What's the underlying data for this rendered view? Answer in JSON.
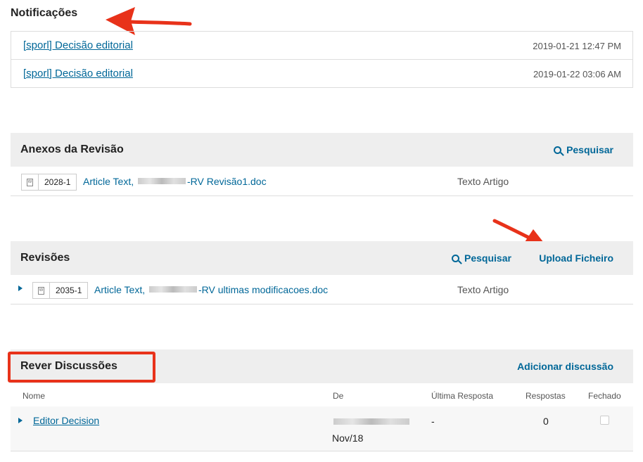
{
  "notifications": {
    "title": "Notificações",
    "items": [
      {
        "label": "[sporl] Decisão editorial",
        "date": "2019-01-21 12:47 PM"
      },
      {
        "label": "[sporl] Decisão editorial",
        "date": "2019-01-22 03:06 AM"
      }
    ]
  },
  "attachments": {
    "title": "Anexos da Revisão",
    "search_label": "Pesquisar",
    "file": {
      "id": "2028-1",
      "name_prefix": "Article Text,",
      "name_suffix": "-RV Revisão1.doc",
      "type": "Texto Artigo"
    }
  },
  "revisions": {
    "title": "Revisões",
    "search_label": "Pesquisar",
    "upload_label": "Upload Ficheiro",
    "file": {
      "id": "2035-1",
      "name_prefix": "Article Text,",
      "name_suffix": "-RV ultimas modificacoes.doc",
      "type": "Texto Artigo"
    }
  },
  "discussions": {
    "title": "Rever Discussões",
    "add_label": "Adicionar discussão",
    "columns": [
      "Nome",
      "De",
      "Última Resposta",
      "Respostas",
      "Fechado"
    ],
    "rows": [
      {
        "name": "Editor Decision",
        "from_date": "Nov/18",
        "last_reply": "-",
        "replies": "0",
        "closed": false
      }
    ]
  },
  "colors": {
    "link": "#006798",
    "header_bg": "#eeeeee",
    "annotation": "#e8321a"
  },
  "icons": [
    "search-icon",
    "file-doc-icon",
    "expand-triangle-icon",
    "checkbox-icon",
    "annotation-arrow-icon"
  ]
}
